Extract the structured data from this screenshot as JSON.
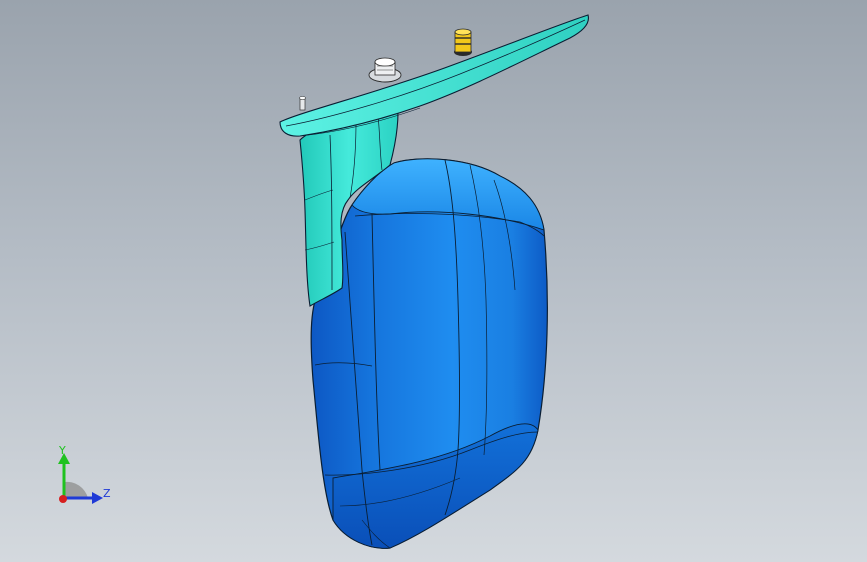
{
  "viewport": {
    "colors": {
      "background_top": "#9aa3ad",
      "background_bottom": "#d4d9de",
      "mirror_housing": "#1a86e6",
      "mirror_housing_shadow": "#0c56c0",
      "bracket": "#3ae0d2",
      "bracket_shadow": "#1fb7a8",
      "edge_lines": "#0a1e33"
    },
    "model": {
      "name": "side-mirror-assembly",
      "parts": [
        "mounting-plate",
        "mounting-arm",
        "mirror-housing",
        "bolt-fastener",
        "yellow-connector",
        "pin-fastener"
      ]
    }
  },
  "triad": {
    "y_label": "Y",
    "z_label": "Z",
    "colors": {
      "y_axis": "#1fc21f",
      "z_axis": "#1f3ad6",
      "x_axis": "#d61f1f",
      "rotation_arc": "#8e8e8e"
    }
  }
}
